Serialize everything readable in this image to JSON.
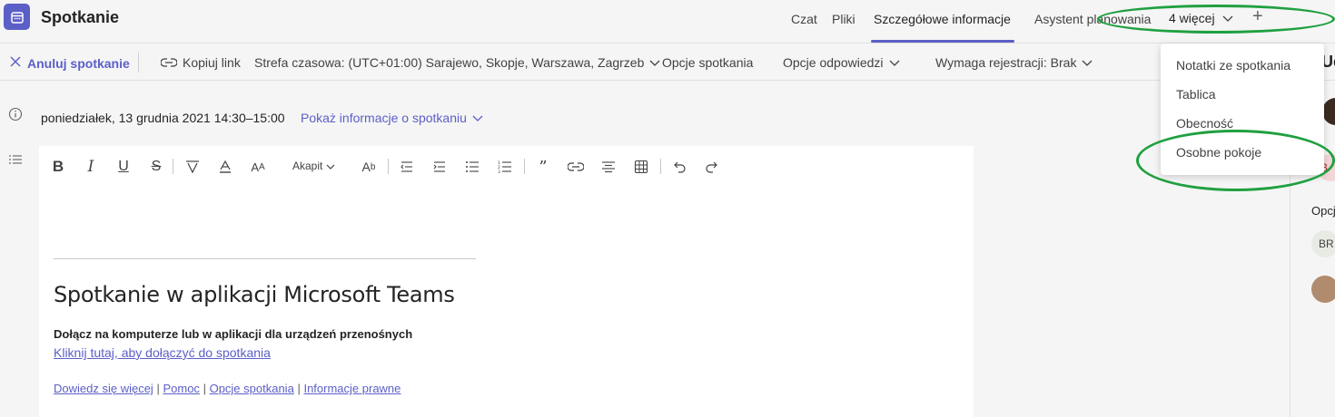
{
  "header": {
    "app_title": "Spotkanie",
    "tabs": [
      {
        "label": "Czat"
      },
      {
        "label": "Pliki"
      },
      {
        "label": "Szczegółowe informacje"
      },
      {
        "label": "Asystent planowania"
      }
    ],
    "more_tabs_label": "4 więcej",
    "add_tab_symbol": "+"
  },
  "commands": {
    "cancel": "Anuluj spotkanie",
    "copy_link": "Kopiuj link",
    "timezone": "Strefa czasowa: (UTC+01:00) Sarajewo, Skopje, Warszawa, Zagrzeb",
    "meeting_options": "Opcje spotkania",
    "response_options": "Opcje odpowiedzi",
    "registration": "Wymaga rejestracji: Brak"
  },
  "info": {
    "date": "poniedziałek, 13 grudnia 2021 14:30–15:00",
    "show_info": "Pokaż informacje o spotkaniu"
  },
  "editor": {
    "style_label": "Akapit",
    "meeting_title": "Spotkanie w aplikacji Microsoft Teams",
    "join_text": "Dołącz na komputerze lub w aplikacji dla urządzeń przenośnych",
    "join_link": "Kliknij tutaj, aby dołączyć do spotkania",
    "footer_links": [
      "Dowiedz się więcej",
      "Pomoc",
      "Opcje spotkania",
      "Informacje prawne"
    ],
    "footer_sep": "|"
  },
  "right_pane": {
    "title": "Ue",
    "avatar_initials_1": "B",
    "opcje_label": "Opcje",
    "avatar_initials_2": "BR"
  },
  "menu": {
    "items": [
      "Notatki ze spotkania",
      "Tablica",
      "Obecność",
      "Osobne pokoje"
    ]
  },
  "colors": {
    "accent": "#5b5fc7",
    "annotation": "#20a040"
  }
}
